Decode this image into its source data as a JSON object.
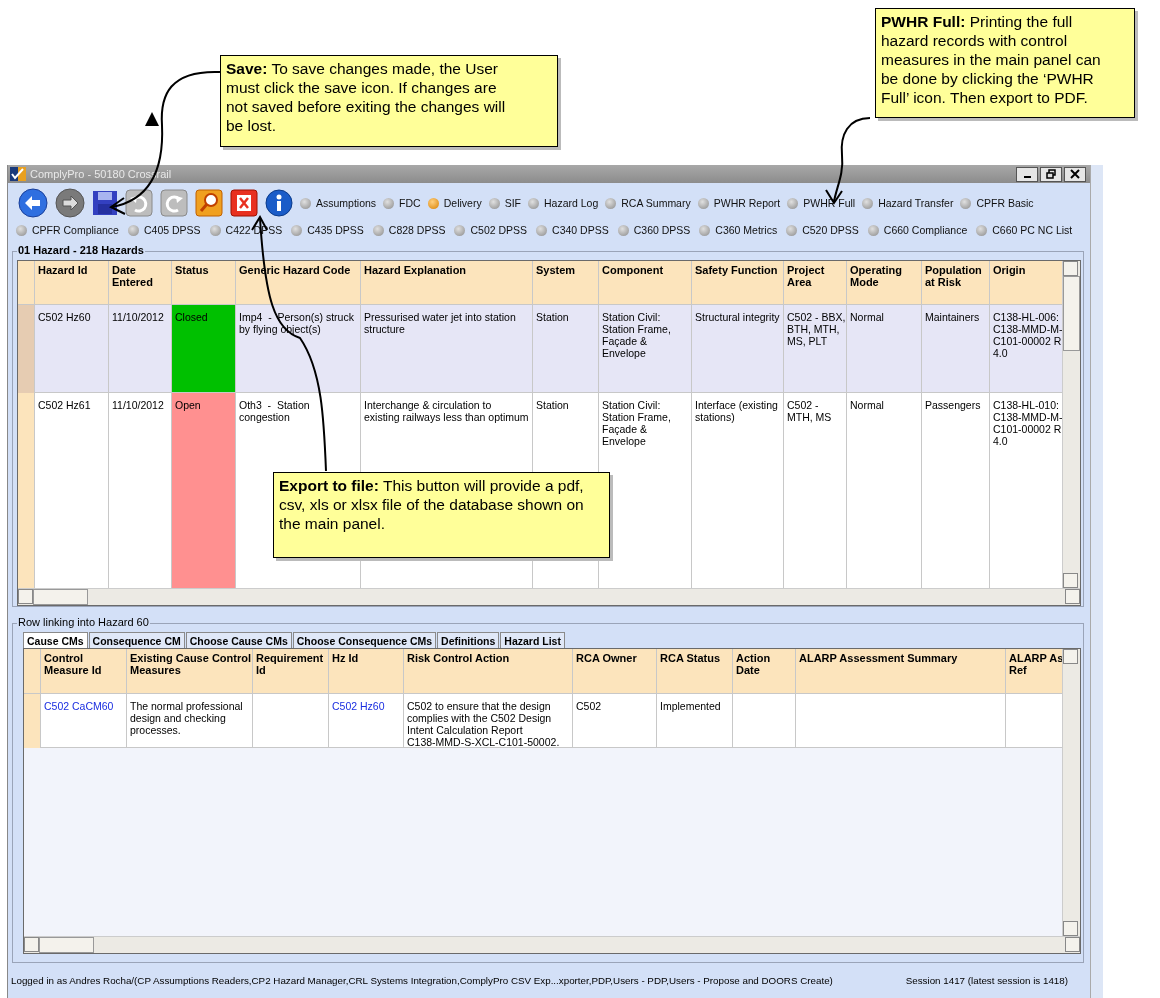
{
  "callouts": [
    {
      "kind": "save",
      "text": "**Save:** To save changes made, the User must click the save icon. If changes are not saved before exiting the changes will be lost."
    },
    {
      "kind": "pwhr",
      "text": "**PWHR Full:** Printing the full hazard records with control measures in the main panel can be done by clicking the ‘PWHR Full’ icon. Then export to PDF."
    },
    {
      "kind": "export",
      "text": "**Export to file:** This button will provide a pdf, csv, xls or xlsx file of the database shown on the main panel."
    }
  ],
  "window": {
    "title": "ComplyPro - 50180 Crossrail"
  },
  "reports_row1": [
    {
      "label": "Assumptions",
      "selected": false
    },
    {
      "label": "FDC",
      "selected": false
    },
    {
      "label": "Delivery",
      "selected": true
    },
    {
      "label": "SIF",
      "selected": false
    },
    {
      "label": "Hazard Log",
      "selected": false
    },
    {
      "label": "RCA Summary",
      "selected": false
    },
    {
      "label": "PWHR Report",
      "selected": false
    },
    {
      "label": "PWHR Full",
      "selected": false
    },
    {
      "label": "Hazard Transfer",
      "selected": false
    },
    {
      "label": "CPFR Basic",
      "selected": false
    }
  ],
  "reports_row2": [
    {
      "label": "CPFR Compliance",
      "selected": false
    },
    {
      "label": "C405 DPSS",
      "selected": false
    },
    {
      "label": "C422 DPSS",
      "selected": false
    },
    {
      "label": "C435 DPSS",
      "selected": false
    },
    {
      "label": "C828 DPSS",
      "selected": false
    },
    {
      "label": "C502 DPSS",
      "selected": false
    },
    {
      "label": "C340 DPSS",
      "selected": false
    },
    {
      "label": "C360 DPSS",
      "selected": false
    },
    {
      "label": "C360 Metrics",
      "selected": false
    },
    {
      "label": "C520 DPSS",
      "selected": false
    },
    {
      "label": "C660 Compliance",
      "selected": false
    },
    {
      "label": "C660 PC NC List",
      "selected": false
    }
  ],
  "hazard_panel": {
    "title": "01 Hazard - 218 Hazards",
    "columns": [
      "Hazard Id",
      "Date\nEntered",
      "Status",
      "Generic Hazard Code",
      "Hazard Explanation",
      "System",
      "Component",
      "Safety Function",
      "Project\nArea",
      "Operating\nMode",
      "Population\nat Risk",
      "Origin"
    ],
    "rows": [
      {
        "selected": true,
        "color": "#00c000",
        "cells": [
          "C502 Hz60",
          "11/10/2012",
          "Closed",
          "Imp4  -  Person(s) struck\nby flying object(s)",
          "Pressurised water jet into station\nstructure",
          "Station",
          "Station Civil:\nStation Frame,\nFaçade &\nEnvelope",
          "Structural integrity",
          "C502 - BBX,\nBTH, MTH,\nMS, PLT",
          "Normal",
          "Maintainers",
          "C138-HL-006:\nC138-MMD-M-\nC101-00002 R\n4.0"
        ]
      },
      {
        "selected": false,
        "color": "#ff9090",
        "cells": [
          "C502 Hz61",
          "11/10/2012",
          "Open",
          "Oth3  -  Station\ncongestion",
          "Interchange & circulation to\nexisting railways less than optimum",
          "Station",
          "Station Civil:\nStation Frame,\nFaçade &\nEnvelope",
          "Interface (existing\nstations)",
          "C502 -\nMTH, MS",
          "Normal",
          "Passengers",
          "C138-HL-010:\nC138-MMD-M-\nC101-00002 R\n4.0"
        ]
      }
    ]
  },
  "linking_panel": {
    "title": "Row linking into Hazard 60",
    "tabs": [
      {
        "label": "Cause CMs",
        "selected": true
      },
      {
        "label": "Consequence CM",
        "selected": false
      },
      {
        "label": "Choose Cause CMs",
        "selected": false
      },
      {
        "label": "Choose Consequence CMs",
        "selected": false
      },
      {
        "label": "Definitions",
        "selected": false
      },
      {
        "label": "Hazard List",
        "selected": false
      }
    ],
    "columns": [
      "Control\nMeasure Id",
      "Existing Cause Control\nMeasures",
      "Requirement\nId",
      "Hz Id",
      "Risk Control Action",
      "RCA Owner",
      "RCA Status",
      "Action\nDate",
      "ALARP Assessment Summary",
      "ALARP As\nRef"
    ],
    "rows": [
      [
        {
          "text": "C502 CaCM60",
          "link": true
        },
        {
          "text": "The normal professional\ndesign and checking\nprocesses.",
          "link": false
        },
        null,
        {
          "text": "C502 Hz60",
          "link": true
        },
        {
          "text": "C502 to ensure that the design\ncomplies with the C502 Design\nIntent Calculation Report\nC138-MMD-S-XCL-C101-50002.",
          "link": false
        },
        {
          "text": "C502",
          "link": false
        },
        {
          "text": "Implemented",
          "link": false
        },
        null,
        null,
        null
      ]
    ]
  },
  "status_bar": {
    "user": "Logged in as Andres Rocha/(CP Assumptions Readers,CP2 Hazard Manager,CRL Systems Integration,ComplyPro CSV Exp...xporter,PDP,Users - PDP,Users - Propose and DOORS Create)",
    "session": "Session 1417 (latest session is 1418)"
  }
}
